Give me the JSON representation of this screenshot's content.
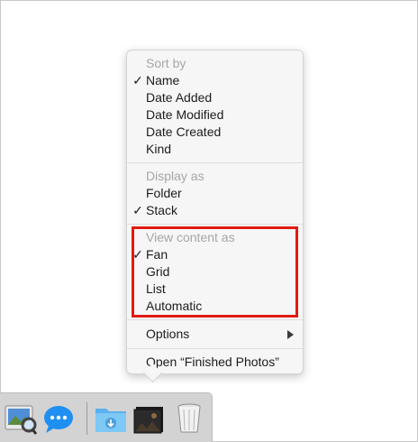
{
  "menu": {
    "sort_header": "Sort by",
    "sort_items": [
      {
        "label": "Name",
        "checked": true
      },
      {
        "label": "Date Added",
        "checked": false
      },
      {
        "label": "Date Modified",
        "checked": false
      },
      {
        "label": "Date Created",
        "checked": false
      },
      {
        "label": "Kind",
        "checked": false
      }
    ],
    "display_header": "Display as",
    "display_items": [
      {
        "label": "Folder",
        "checked": false
      },
      {
        "label": "Stack",
        "checked": true
      }
    ],
    "view_header": "View content as",
    "view_items": [
      {
        "label": "Fan",
        "checked": true
      },
      {
        "label": "Grid",
        "checked": false
      },
      {
        "label": "List",
        "checked": false
      },
      {
        "label": "Automatic",
        "checked": false
      }
    ],
    "options_label": "Options",
    "open_label": "Open “Finished Photos”",
    "check_glyph": "✓"
  },
  "highlight_color": "#e01b12",
  "dock": {
    "icons": [
      "preview-app-icon",
      "messages-app-icon",
      "downloads-folder-icon",
      "finished-photos-stack-icon",
      "trash-icon"
    ]
  }
}
